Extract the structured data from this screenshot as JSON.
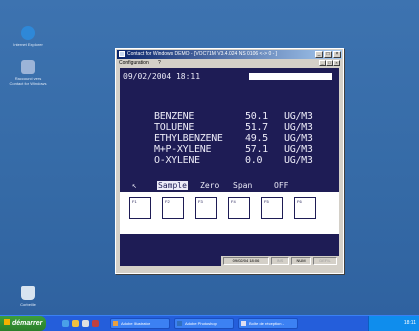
{
  "desktop": {
    "icons": [
      {
        "label": "Internet Explorer",
        "icon": "internet-explorer-icon"
      },
      {
        "label": "Raccourci vers Contact for Windows",
        "icon": "shortcut-icon"
      },
      {
        "label": "Corbeille",
        "icon": "recycle-bin-icon"
      }
    ]
  },
  "window": {
    "title": "Contact for Windows  DEMO  - [VOC71M V3.4.024  NS  0106 <-> 0 - ]",
    "menu": [
      "Configuration",
      "?"
    ]
  },
  "analyzer": {
    "datetime": "09/02/2004  18:11",
    "rows": [
      {
        "name": "BENZENE",
        "value": "50.1",
        "unit": "UG/M3"
      },
      {
        "name": "TOLUENE",
        "value": "51.7",
        "unit": "UG/M3"
      },
      {
        "name": "ETHYLBENZENE",
        "value": "49.5",
        "unit": "UG/M3"
      },
      {
        "name": "M+P-XYLENE",
        "value": "57.1",
        "unit": "UG/M3"
      },
      {
        "name": "O-XYLENE",
        "value": "0.0",
        "unit": "UG/M3"
      }
    ],
    "modes": {
      "back": "↖",
      "sample": "Sample",
      "zero": "Zero",
      "span": "Span",
      "off": "OFF"
    },
    "fkeys": [
      "F1",
      "F2",
      "F3",
      "F4",
      "F5",
      "F6"
    ]
  },
  "status": {
    "datetime": "09/02/04  18:06",
    "ins": "INS",
    "num": "NUM",
    "scroll": "DEFIL"
  },
  "taskbar": {
    "start": "démarrer",
    "tasks": [
      "Adobe Illustrator",
      "Adobe Photoshop",
      "Boîte de réception -"
    ],
    "clock": "18:11"
  }
}
